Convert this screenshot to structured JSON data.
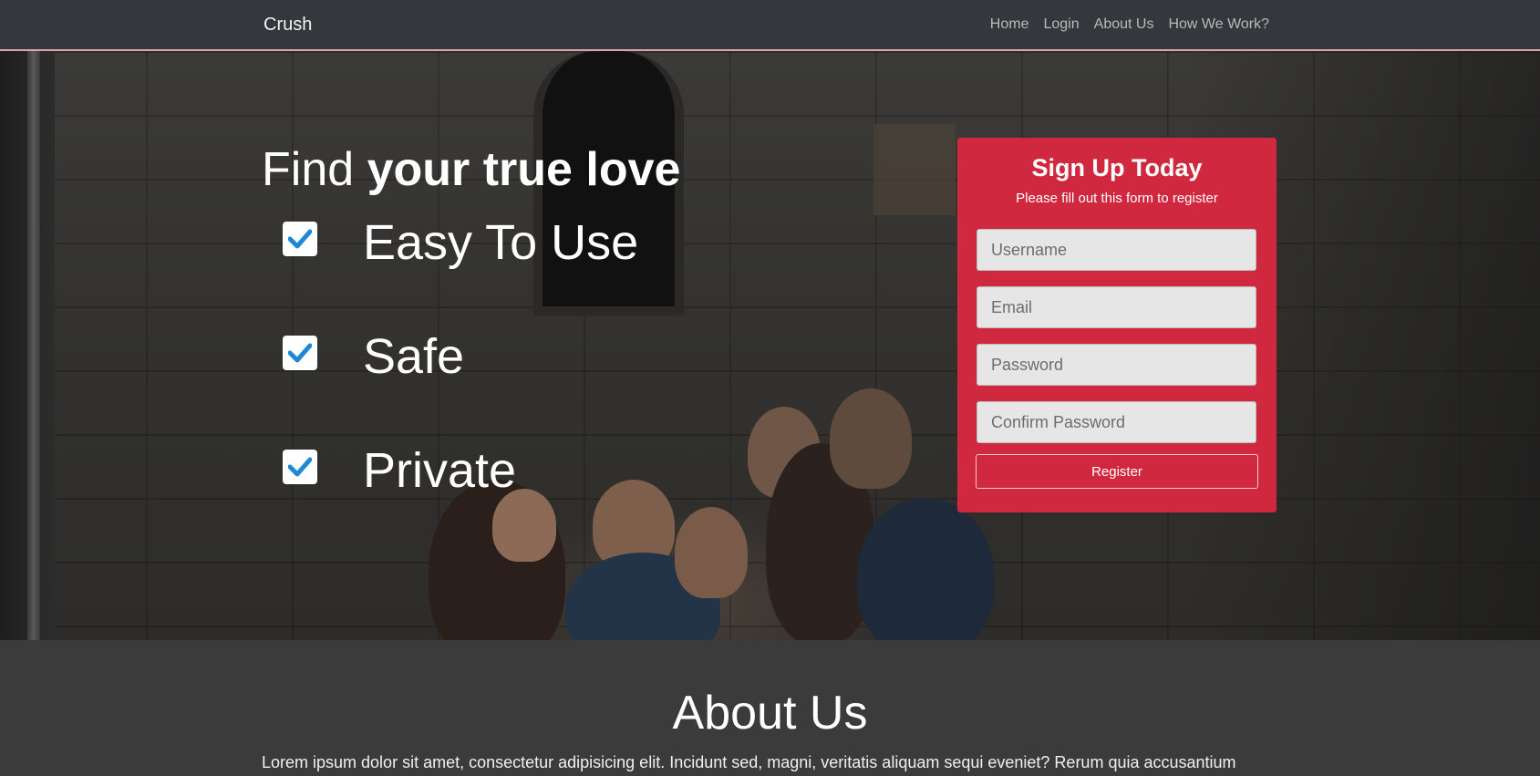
{
  "navbar": {
    "brand": "Crush",
    "links": [
      "Home",
      "Login",
      "About Us",
      "How We Work?"
    ]
  },
  "hero": {
    "title_light": "Find",
    "title_bold": "your true love",
    "features": [
      "Easy To Use",
      "Safe",
      "Private"
    ]
  },
  "signup": {
    "title": "Sign Up Today",
    "subtitle": "Please fill out this form to register",
    "fields": {
      "username": "Username",
      "email": "Email",
      "password": "Password",
      "confirm": "Confirm Password"
    },
    "button": "Register"
  },
  "about": {
    "title": "About Us",
    "text": "Lorem ipsum dolor sit amet, consectetur adipisicing elit. Incidunt sed, magni, veritatis aliquam sequi eveniet? Rerum quia accusantium"
  },
  "colors": {
    "accent": "#d0283e",
    "check": "#1e88d6",
    "navbar": "#34373b"
  },
  "icons": [
    "check-icon"
  ]
}
